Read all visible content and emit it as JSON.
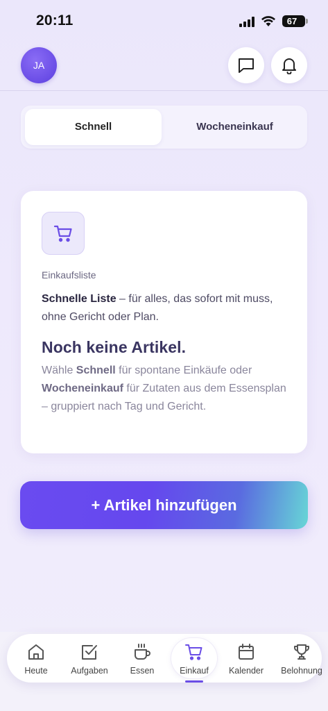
{
  "status_bar": {
    "time": "20:11",
    "battery_level": "67",
    "icons": [
      "signal-icon",
      "wifi-icon",
      "battery-icon"
    ]
  },
  "header": {
    "avatar_initials": "JA",
    "icons": [
      "chat-icon",
      "bell-icon"
    ]
  },
  "segment": {
    "tabs": [
      {
        "label": "Schnell",
        "active": true
      },
      {
        "label": "Wocheneinkauf",
        "active": false
      }
    ]
  },
  "card": {
    "icon": "cart-icon",
    "eyebrow": "Einkaufsliste",
    "intro_bold": "Schnelle Liste",
    "intro_rest": " – für alles, das sofort mit muss, ohne Gericht oder Plan.",
    "heading": "Noch keine Artikel.",
    "body_prefix": "Wähle ",
    "body_bold_1": "Schnell",
    "body_mid": " für spontane Einkäufe oder ",
    "body_bold_2": "Wocheneinkauf",
    "body_suffix": " für Zutaten aus dem Essensplan – gruppiert nach Tag und Gericht."
  },
  "primary_button": {
    "label": "+ Artikel hinzufügen"
  },
  "bottom_nav": {
    "items": [
      {
        "label": "Heute",
        "icon": "home-icon"
      },
      {
        "label": "Aufgaben",
        "icon": "checkbox-icon"
      },
      {
        "label": "Essen",
        "icon": "coffee-cup-icon"
      },
      {
        "label": "Einkauf",
        "icon": "cart-icon",
        "active": true
      },
      {
        "label": "Kalender",
        "icon": "calendar-icon"
      },
      {
        "label": "Belohnung",
        "icon": "trophy-icon"
      }
    ]
  },
  "colors": {
    "accent": "#6a4de6",
    "background": "#ebe7fb",
    "card": "#ffffff",
    "heading": "#3a3561"
  }
}
